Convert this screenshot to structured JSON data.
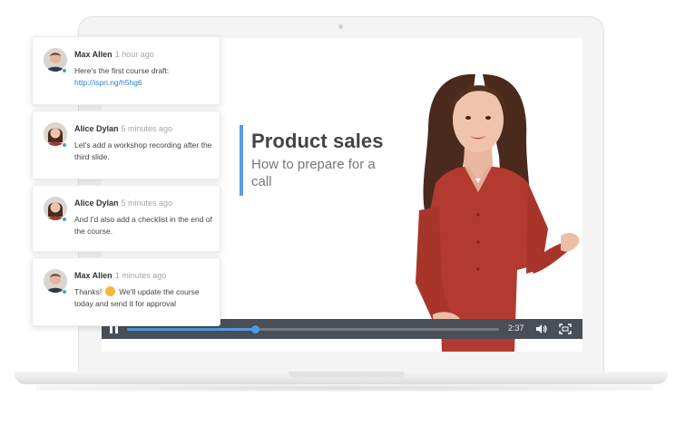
{
  "slide": {
    "title": "Product sales",
    "subtitle": "How to prepare for a call"
  },
  "player": {
    "time": "2:37",
    "progress_fraction": 0.345,
    "icons": [
      "pause-icon",
      "volume-icon",
      "fullscreen-icon"
    ]
  },
  "comments": [
    {
      "name": "Max Allen",
      "time": "1 hour ago",
      "text": "Here's the first course draft:",
      "link": "http://ispri.ng/h5hg6"
    },
    {
      "name": "Alice Dylan",
      "time": "5 minutes ago",
      "text": "Let's add a workshop recording after the third slide."
    },
    {
      "name": "Alice Dylan",
      "time": "5 minutes ago",
      "text": "And I'd also add a checklist in the end of the course."
    },
    {
      "name": "Max Allen",
      "time": "1 minutes ago",
      "text_before": "Thanks!",
      "text_after": "We'll update the course today and send it for approval"
    }
  ],
  "colors": {
    "accent": "#4d9be6",
    "player_bar": "#4a4f57",
    "blouse": "#b23a2e"
  }
}
